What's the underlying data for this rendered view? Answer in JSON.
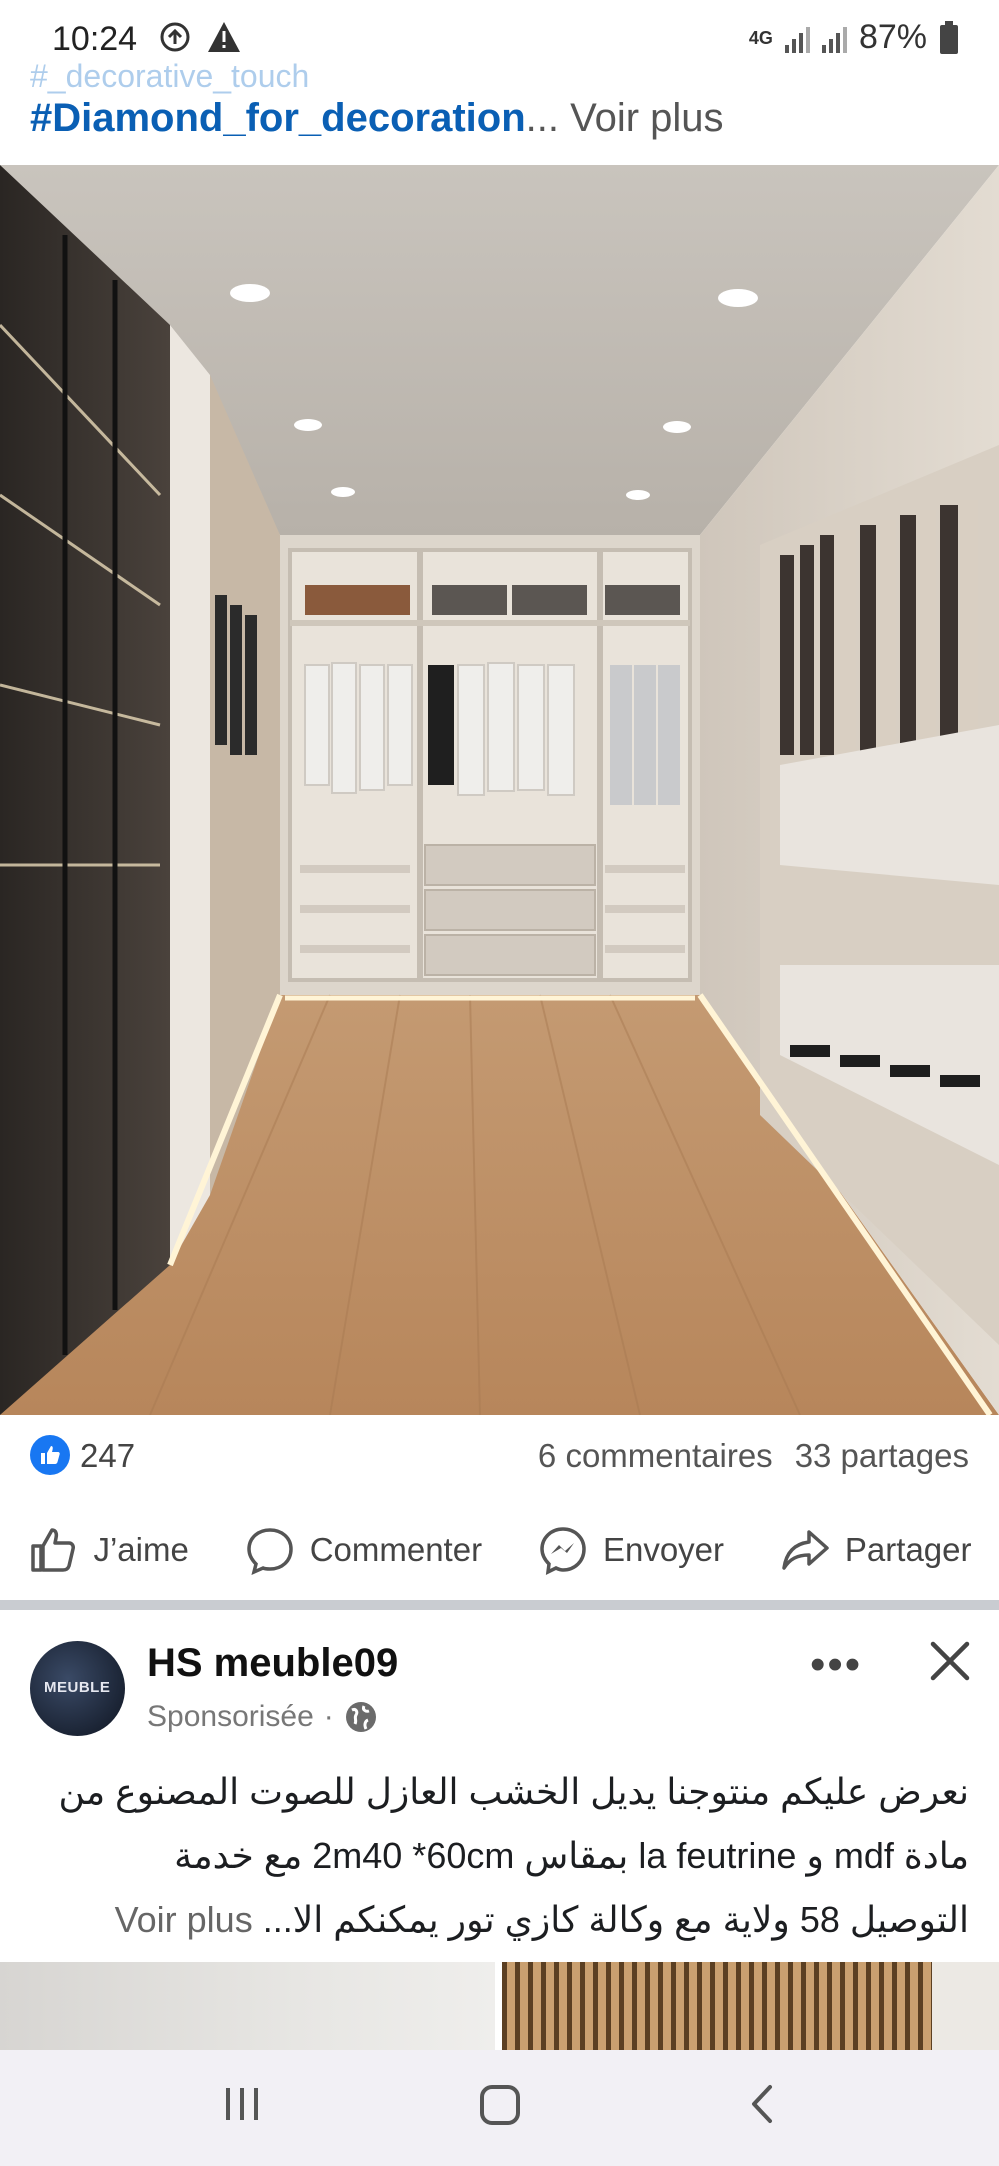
{
  "status_bar": {
    "time": "10:24",
    "network": "4G",
    "battery": "87%",
    "icons": [
      "data-saver-icon",
      "warning-icon",
      "signal-icon",
      "signal-icon",
      "battery-icon"
    ]
  },
  "post": {
    "hashtag_faded": "#_decorative_touch",
    "hashtag": "#Diamond_for_decoration",
    "ellipsis": "...",
    "see_more": " Voir plus",
    "likes_count": "247",
    "comments": "6 commentaires",
    "shares": "33 partages"
  },
  "actions": {
    "like": "J’aime",
    "comment": "Commenter",
    "send": "Envoyer",
    "share": "Partager"
  },
  "sponsored_post": {
    "page_name": "HS meuble09",
    "avatar_text": "MEUBLE",
    "sponsored_label": "Sponsorisée",
    "dot": "·",
    "body_line1": "نعرض عليكم منتوجنا يديل الخشب العازل للصوت المصنوع من",
    "body_line2": "مادة mdf و la feutrine بمقاس 2m40 *60cm مع خدمة",
    "body_line3": "التوصيل 58 ولاية مع وكالة كازي تور يمكنكم الا...",
    "see_more": "Voir plus"
  },
  "colors": {
    "hashtag": "#0a5fb4",
    "like_blue": "#1877f2",
    "separator": "#c9ccd1",
    "nav_bar": "#f2f0f5"
  }
}
